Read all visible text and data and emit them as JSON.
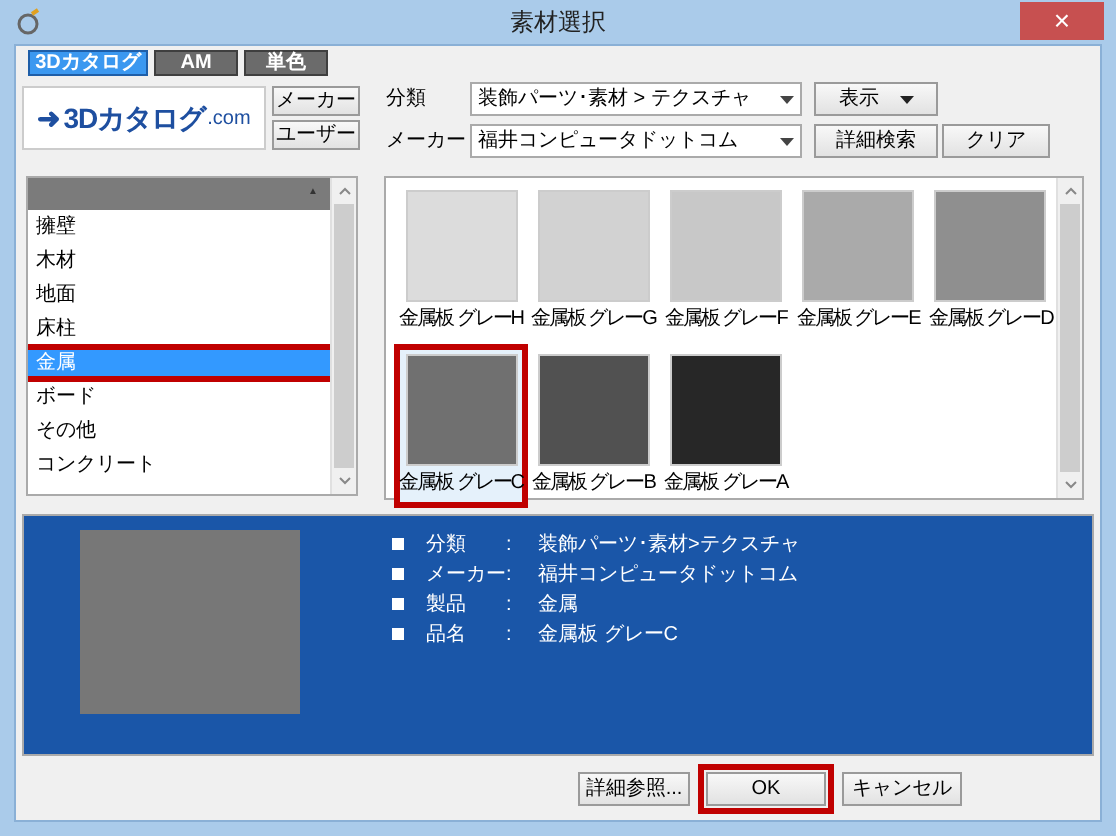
{
  "window": {
    "title": "素材選択",
    "close": "×"
  },
  "tabs": [
    {
      "label": "3Dカタログ",
      "selected": true
    },
    {
      "label": "AM",
      "selected": false
    },
    {
      "label": "単色",
      "selected": false
    }
  ],
  "logo": {
    "arrow": "➜",
    "brand": "3Dカタログ",
    "suffix": ".com"
  },
  "source_buttons": [
    "メーカー",
    "ユーザー"
  ],
  "filters": [
    {
      "label": "分類",
      "value": "装飾パーツ･素材 > テクスチャ",
      "button": "表示",
      "button_caret": true
    },
    {
      "label": "メーカー",
      "value": "福井コンピュータドットコム",
      "button": "詳細検索",
      "extra_button": "クリア"
    }
  ],
  "category_list": {
    "header_arrow": "▲",
    "items": [
      {
        "label": "擁壁",
        "selected": false
      },
      {
        "label": "木材",
        "selected": false
      },
      {
        "label": "地面",
        "selected": false
      },
      {
        "label": "床柱",
        "selected": false
      },
      {
        "label": "金属",
        "selected": true
      },
      {
        "label": "ボード",
        "selected": false
      },
      {
        "label": "その他",
        "selected": false
      },
      {
        "label": "コンクリート",
        "selected": false
      }
    ]
  },
  "thumbnails": [
    {
      "label": "金属板 グレーH",
      "color": "#dcdcdc",
      "selected": false
    },
    {
      "label": "金属板 グレーG",
      "color": "#d2d2d2",
      "selected": false
    },
    {
      "label": "金属板 グレーF",
      "color": "#c8c8c8",
      "selected": false
    },
    {
      "label": "金属板 グレーE",
      "color": "#aaaaaa",
      "selected": false
    },
    {
      "label": "金属板 グレーD",
      "color": "#8f8f8f",
      "selected": false
    },
    {
      "label": "金属板 グレーC",
      "color": "#707070",
      "selected": true
    },
    {
      "label": "金属板 グレーB",
      "color": "#515151",
      "selected": false
    },
    {
      "label": "金属板 グレーA",
      "color": "#272727",
      "selected": false
    }
  ],
  "details": {
    "rows": [
      {
        "label": "分類",
        "separator": ":",
        "value": "装飾パーツ･素材>テクスチャ"
      },
      {
        "label": "メーカー",
        "separator": ":",
        "value": "福井コンピュータドットコム"
      },
      {
        "label": "製品",
        "separator": ":",
        "value": "金属"
      },
      {
        "label": "品名",
        "separator": ":",
        "value": "金属板 グレーC"
      }
    ]
  },
  "buttons": [
    {
      "label": "詳細参照...",
      "highlighted": false
    },
    {
      "label": "OK",
      "highlighted": true
    },
    {
      "label": "キャンセル",
      "highlighted": false
    }
  ]
}
